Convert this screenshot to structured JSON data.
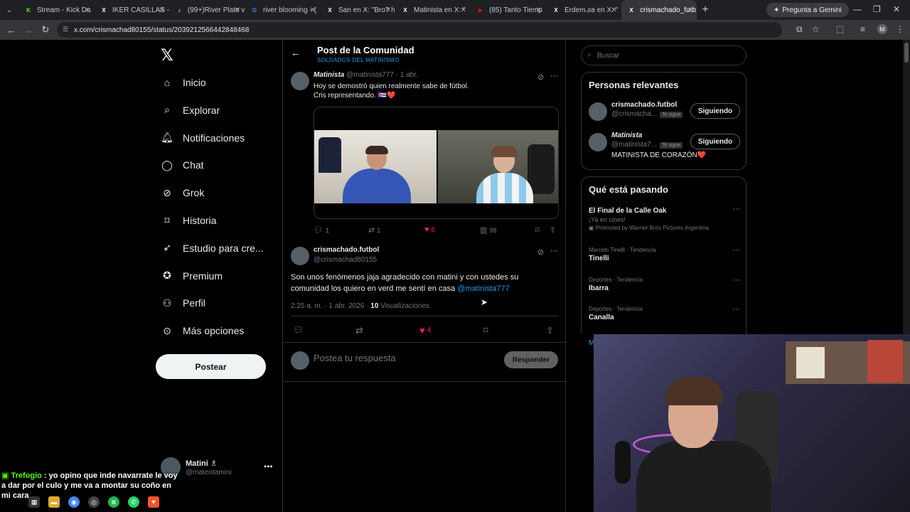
{
  "browser": {
    "tabs": [
      {
        "label": "Stream - Kick Da",
        "icon_color": "#53fc18",
        "glyph": "K"
      },
      {
        "label": "IKER CASILLAS - E",
        "icon_color": "#ffffff",
        "glyph": "X"
      },
      {
        "label": "(99+)River Plate v",
        "icon_color": "#ffffff",
        "glyph": "♪"
      },
      {
        "label": "river blooming - (",
        "icon_color": "#4285f4",
        "glyph": "G"
      },
      {
        "label": "San en X: \"Bro? h",
        "icon_color": "#ffffff",
        "glyph": "X"
      },
      {
        "label": "Matinista en X: \"",
        "icon_color": "#ffffff",
        "glyph": "X"
      },
      {
        "label": "(85) Tanto Tiemp",
        "icon_color": "#ff0000",
        "glyph": "▶"
      },
      {
        "label": "Erdem.ƨa en X: \"",
        "icon_color": "#ffffff",
        "glyph": "X"
      },
      {
        "label": "crismachado_futb",
        "icon_color": "#ffffff",
        "glyph": "X"
      }
    ],
    "gemini_label": "Pregunta a Gemini",
    "url": "x.com/crismachad80155/status/2039212566442848468"
  },
  "nav": {
    "items": [
      {
        "label": "Inicio",
        "icon": "home-icon"
      },
      {
        "label": "Explorar",
        "icon": "search-icon"
      },
      {
        "label": "Notificaciones",
        "icon": "bell-icon"
      },
      {
        "label": "Chat",
        "icon": "chat-icon"
      },
      {
        "label": "Grok",
        "icon": "grok-icon"
      },
      {
        "label": "Historia",
        "icon": "bookmark-icon"
      },
      {
        "label": "Estudio para cre...",
        "icon": "rocket-icon"
      },
      {
        "label": "Premium",
        "icon": "check-badge-icon"
      },
      {
        "label": "Perfil",
        "icon": "person-icon"
      },
      {
        "label": "Más opciones",
        "icon": "more-circle-icon"
      }
    ],
    "post_button": "Postear",
    "account": {
      "name": "Matini ♗",
      "handle": "@mateotamini"
    }
  },
  "main": {
    "title": "Post de la Comunidad",
    "subtitle": "SOLDADOS DEL MATINISMO",
    "post1": {
      "name": "Matinista",
      "handle": "@matinista777",
      "time": "· 1 abr.",
      "line1": "Hoy se demostró quien realmente sabe de fútbol.",
      "line2": "Cris representando. 🇨🇺❤️",
      "replies": "1",
      "reposts": "1",
      "likes": "8",
      "views": "98"
    },
    "post2": {
      "name": "crismachado.futbol",
      "handle": "@crismachad80155",
      "text": "Son unos fenómenos jaja agradecido con matini y con ustedes su comunidad los quiero en verd me sentí en casa ",
      "mention": "@matinista777",
      "meta_time": "2:25 a. m. · 1 abr. 2026 · ",
      "meta_views": "10",
      "meta_views_label": " Visualizaciones",
      "likes": "4"
    },
    "reply": {
      "placeholder": "Postea tu respuesta",
      "button": "Responder"
    }
  },
  "right": {
    "search_placeholder": "Buscar",
    "relevant_title": "Personas relevantes",
    "people": [
      {
        "name": "crismachado.futbol",
        "handle": "@crismacha...",
        "badge": "Te sigue",
        "button": "Siguiendo",
        "bio": ""
      },
      {
        "name": "Matinista",
        "handle": "@matinista7...",
        "badge": "Te sigue",
        "button": "Siguiendo",
        "bio": "MATINISTA DE CORAZÓN❤️"
      }
    ],
    "trending_title": "Qué está pasando",
    "trends": [
      {
        "category": "",
        "name": "El Final de la Calle Oak",
        "sub": "¡Ya en cines!",
        "promo": "Promoted by Warner Bros Pictures Argentina"
      },
      {
        "category": "Marcelo Tinelli · Tendencia",
        "name": "Tinelli",
        "sub": "",
        "promo": ""
      },
      {
        "category": "Deportes · Tendencia",
        "name": "Ibarra",
        "sub": "",
        "promo": ""
      },
      {
        "category": "Deportes · Tendencia",
        "name": "Canalla",
        "sub": "",
        "promo": ""
      }
    ],
    "more_link": "M"
  },
  "chat_overlay": {
    "user": "Trefogio",
    "message": " : yo opino que inde navarrate le voy a dar por el culo y me va a montar su coño en mi cara"
  }
}
